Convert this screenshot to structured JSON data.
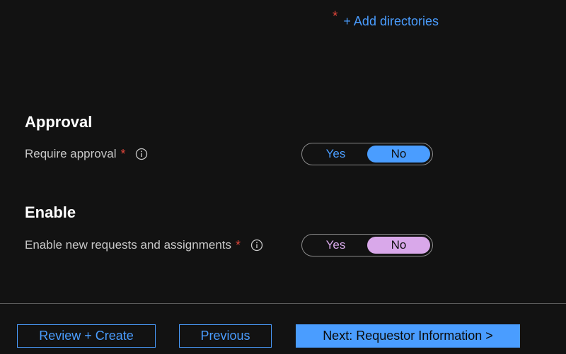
{
  "directories": {
    "required_marker": "*",
    "add_link": "+ Add directories"
  },
  "approval": {
    "heading": "Approval",
    "field_label": "Require approval",
    "required_marker": "*",
    "toggle": {
      "yes": "Yes",
      "no": "No",
      "selected": "No"
    }
  },
  "enable": {
    "heading": "Enable",
    "field_label": "Enable new requests and assignments",
    "required_marker": "*",
    "toggle": {
      "yes": "Yes",
      "no": "No",
      "selected": "No"
    }
  },
  "footer": {
    "review_create": "Review + Create",
    "previous": "Previous",
    "next": "Next: Requestor Information >"
  },
  "colors": {
    "background": "#121212",
    "accent": "#4a9dff",
    "required": "#e0453a",
    "enable_toggle": "#d9a8ea"
  },
  "icons": {
    "info": "info-icon"
  }
}
